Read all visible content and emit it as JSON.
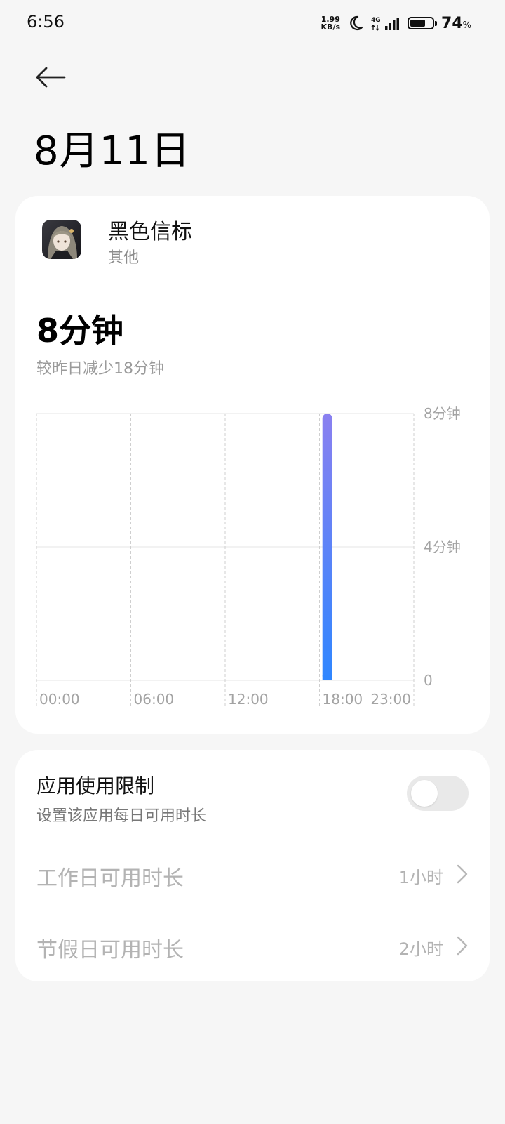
{
  "status_bar": {
    "time": "6:56",
    "net_speed_value": "1.99",
    "net_speed_unit": "KB/s",
    "network_type": "4G",
    "battery_percent": "74",
    "battery_unit": "%",
    "battery_level": 0.74
  },
  "header": {
    "title": "8月11日"
  },
  "app": {
    "name": "黑色信标",
    "category": "其他"
  },
  "usage": {
    "total": "8分钟",
    "compare": "较昨日减少18分钟"
  },
  "chart_data": {
    "type": "bar",
    "x_tick_labels": [
      "00:00",
      "06:00",
      "12:00",
      "18:00",
      "23:00"
    ],
    "y_tick_labels": [
      "8分钟",
      "4分钟",
      "0"
    ],
    "ylim": [
      0,
      8
    ],
    "bars": [
      {
        "hour": 18,
        "minutes": 8
      }
    ],
    "bar_gradient": [
      "#8a80f0",
      "#2f86ff"
    ],
    "grid": true
  },
  "limit": {
    "title": "应用使用限制",
    "subtitle": "设置该应用每日可用时长",
    "enabled": false,
    "workday_label": "工作日可用时长",
    "workday_value": "1小时",
    "holiday_label": "节假日可用时长",
    "holiday_value": "2小时"
  },
  "icons": {
    "back": "back-arrow-icon",
    "moon": "moon-icon",
    "signal": "signal-icon",
    "battery": "battery-icon",
    "chevron": "chevron-right-icon"
  }
}
